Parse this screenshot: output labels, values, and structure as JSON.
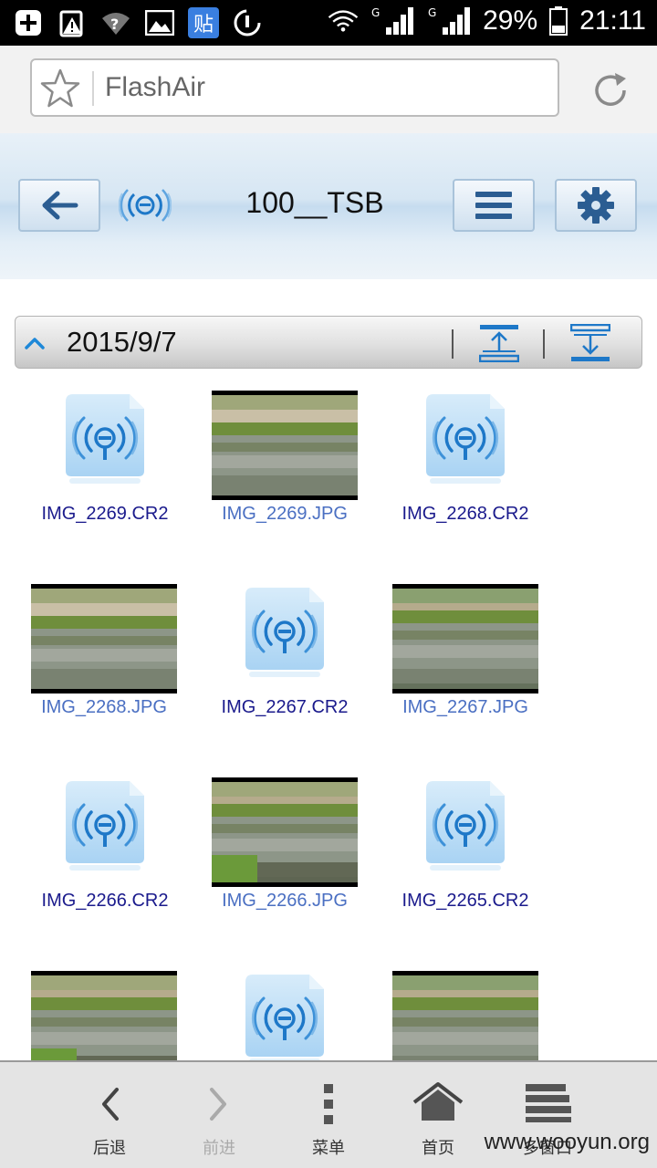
{
  "status_bar": {
    "battery_text": "29%",
    "time": "21:11",
    "icons": [
      "add-icon",
      "warning-icon",
      "wifi-question-icon",
      "image-icon",
      "baidu-tieba-icon",
      "clean-icon",
      "wifi-icon",
      "signal-g-icon",
      "signal-g-icon",
      "battery-icon"
    ]
  },
  "browser": {
    "url_text": "FlashAir",
    "icons": [
      "star-icon",
      "reload-icon"
    ]
  },
  "app_header": {
    "title": "100__TSB",
    "buttons": [
      "back-button",
      "menu-button",
      "settings-button"
    ],
    "colors": {
      "accent": "#1e78c8",
      "icon_dark": "#2a5a8a"
    }
  },
  "date_bar": {
    "date": "2015/9/7",
    "icons": [
      "collapse-chevron-icon",
      "upload-icon",
      "download-icon"
    ]
  },
  "files": [
    {
      "name": "IMG_2269.CR2",
      "kind": "raw"
    },
    {
      "name": "IMG_2269.JPG",
      "kind": "photo"
    },
    {
      "name": "IMG_2268.CR2",
      "kind": "raw"
    },
    {
      "name": "IMG_2268.JPG",
      "kind": "photo"
    },
    {
      "name": "IMG_2267.CR2",
      "kind": "raw"
    },
    {
      "name": "IMG_2267.JPG",
      "kind": "photo"
    },
    {
      "name": "IMG_2266.CR2",
      "kind": "raw"
    },
    {
      "name": "IMG_2266.JPG",
      "kind": "photo"
    },
    {
      "name": "IMG_2265.CR2",
      "kind": "raw"
    },
    {
      "name": "",
      "kind": "photo"
    },
    {
      "name": "",
      "kind": "raw"
    },
    {
      "name": "",
      "kind": "photo"
    }
  ],
  "bottom_bar": {
    "back": "后退",
    "forward": "前进",
    "menu": "菜单",
    "home": "首页",
    "windows": "多窗口",
    "watermark": "www.wooyun.org"
  }
}
